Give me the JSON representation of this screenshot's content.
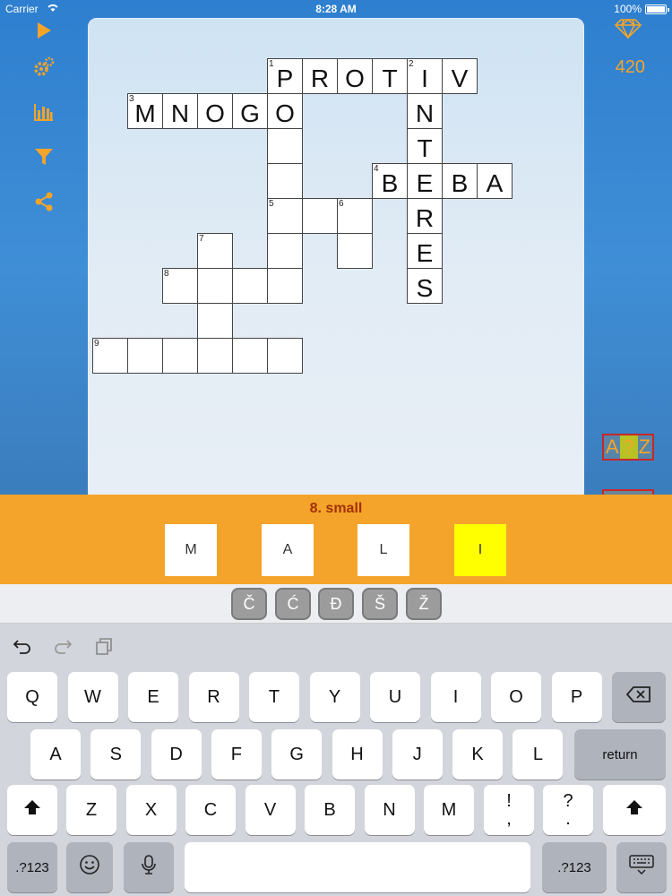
{
  "status_bar": {
    "carrier": "Carrier",
    "time": "8:28 AM",
    "battery": "100%"
  },
  "sidebar": {
    "tools": [
      {
        "name": "play-icon"
      },
      {
        "name": "settings-icon"
      },
      {
        "name": "stats-icon"
      },
      {
        "name": "filter-icon"
      },
      {
        "name": "share-icon"
      }
    ]
  },
  "gems": {
    "count": "420"
  },
  "hint_button": {
    "left": "A",
    "mid": "?",
    "right": "Z"
  },
  "grid": {
    "cells": [
      {
        "r": 0,
        "c": 5,
        "n": "1",
        "l": "P"
      },
      {
        "r": 0,
        "c": 6,
        "l": "R"
      },
      {
        "r": 0,
        "c": 7,
        "l": "O"
      },
      {
        "r": 0,
        "c": 8,
        "l": "T"
      },
      {
        "r": 0,
        "c": 9,
        "n": "2",
        "l": "I"
      },
      {
        "r": 0,
        "c": 10,
        "l": "V"
      },
      {
        "r": 1,
        "c": 1,
        "n": "3",
        "l": "M"
      },
      {
        "r": 1,
        "c": 2,
        "l": "N"
      },
      {
        "r": 1,
        "c": 3,
        "l": "O"
      },
      {
        "r": 1,
        "c": 4,
        "l": "G"
      },
      {
        "r": 1,
        "c": 5,
        "l": "O"
      },
      {
        "r": 1,
        "c": 9,
        "l": "N"
      },
      {
        "r": 2,
        "c": 5,
        "l": ""
      },
      {
        "r": 2,
        "c": 9,
        "l": "T"
      },
      {
        "r": 3,
        "c": 5,
        "l": ""
      },
      {
        "r": 3,
        "c": 8,
        "n": "4",
        "l": "B"
      },
      {
        "r": 3,
        "c": 9,
        "l": "E"
      },
      {
        "r": 3,
        "c": 10,
        "l": "B"
      },
      {
        "r": 3,
        "c": 11,
        "l": "A"
      },
      {
        "r": 4,
        "c": 5,
        "n": "5",
        "l": ""
      },
      {
        "r": 4,
        "c": 6,
        "l": ""
      },
      {
        "r": 4,
        "c": 7,
        "n": "6",
        "l": ""
      },
      {
        "r": 4,
        "c": 9,
        "l": "R"
      },
      {
        "r": 5,
        "c": 3,
        "n": "7",
        "l": ""
      },
      {
        "r": 5,
        "c": 5,
        "l": ""
      },
      {
        "r": 5,
        "c": 7,
        "l": ""
      },
      {
        "r": 5,
        "c": 9,
        "l": "E"
      },
      {
        "r": 6,
        "c": 2,
        "n": "8",
        "l": ""
      },
      {
        "r": 6,
        "c": 3,
        "l": ""
      },
      {
        "r": 6,
        "c": 4,
        "l": ""
      },
      {
        "r": 6,
        "c": 5,
        "l": ""
      },
      {
        "r": 6,
        "c": 9,
        "l": "S"
      },
      {
        "r": 7,
        "c": 3,
        "l": ""
      },
      {
        "r": 8,
        "c": 0,
        "n": "9",
        "l": ""
      },
      {
        "r": 8,
        "c": 1,
        "l": ""
      },
      {
        "r": 8,
        "c": 2,
        "l": ""
      },
      {
        "r": 8,
        "c": 3,
        "l": ""
      },
      {
        "r": 8,
        "c": 4,
        "l": ""
      },
      {
        "r": 8,
        "c": 5,
        "l": ""
      }
    ]
  },
  "clue": {
    "text": "8. small",
    "answer": [
      "M",
      "A",
      "L",
      "I"
    ]
  },
  "special_chars": [
    "Č",
    "Ć",
    "Đ",
    "Š",
    "Ž"
  ],
  "keyboard": {
    "row1": [
      "Q",
      "W",
      "E",
      "R",
      "T",
      "Y",
      "U",
      "I",
      "O",
      "P"
    ],
    "row2": [
      "A",
      "S",
      "D",
      "F",
      "G",
      "H",
      "J",
      "K",
      "L"
    ],
    "row3": [
      "Z",
      "X",
      "C",
      "V",
      "B",
      "N",
      "M"
    ],
    "return_label": "return",
    "numbers_label": ".?123",
    "punct1": [
      "!",
      ","
    ],
    "punct2": [
      "?",
      "."
    ],
    "icons": {
      "undo": "undo-icon",
      "redo": "redo-icon",
      "paste": "paste-icon",
      "backspace": "backspace-icon",
      "shift": "shift-icon",
      "emoji": "emoji-icon",
      "mic": "microphone-icon",
      "hide": "keyboard-hide-icon"
    }
  }
}
